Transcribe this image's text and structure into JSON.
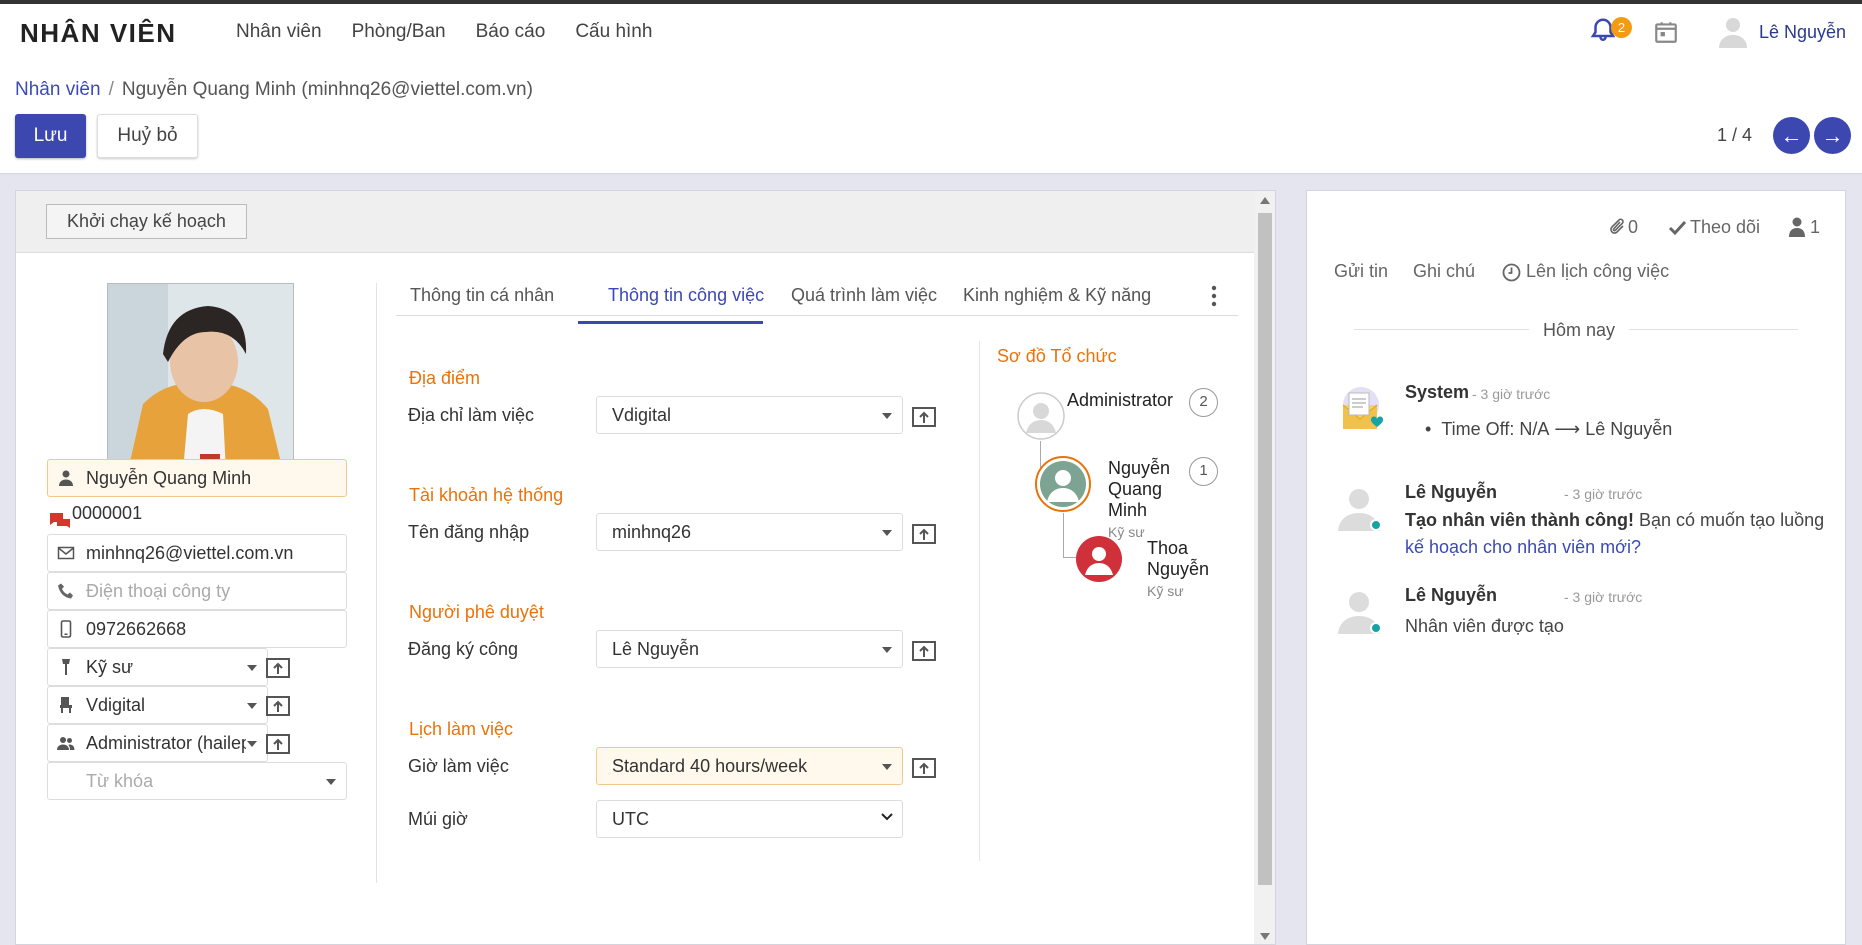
{
  "app": {
    "brand": "NHÂN VIÊN",
    "nav": [
      "Nhân viên",
      "Phòng/Ban",
      "Báo cáo",
      "Cấu hình"
    ],
    "notification_count": "2",
    "user_name": "Lê Nguyễn"
  },
  "breadcrumb": {
    "parent": "Nhân viên",
    "separator": "/",
    "current": "Nguyễn Quang Minh (minhnq26@viettel.com.vn)"
  },
  "actions": {
    "save": "Lưu",
    "cancel": "Huỷ bỏ"
  },
  "pager": {
    "value": "1 / 4"
  },
  "statusbar": {
    "start_plan": "Khởi chạy kế hoạch"
  },
  "employee": {
    "name": "Nguyễn Quang Minh",
    "code": "0000001",
    "email": "minhnq26@viettel.com.vn",
    "work_phone_placeholder": "Điện thoại công ty",
    "mobile": "0972662668",
    "job": "Kỹ sư",
    "department": "Vdigital",
    "manager": "Administrator (haileptit@",
    "tags_placeholder": "Từ khóa"
  },
  "tabs": [
    "Thông tin cá nhân",
    "Thông tin công việc",
    "Quá trình làm việc",
    "Kinh nghiệm & Kỹ năng"
  ],
  "work_info": {
    "location_section": "Địa điểm",
    "work_address_label": "Địa chỉ làm việc",
    "work_address": "Vdigital",
    "account_section": "Tài khoản hệ thống",
    "login_label": "Tên đăng nhập",
    "login": "minhnq26",
    "approver_section": "Người phê duyệt",
    "attendance_label": "Đăng ký công",
    "attendance": "Lê Nguyễn",
    "schedule_section": "Lịch làm việc",
    "hours_label": "Giờ làm việc",
    "hours": "Standard 40 hours/week",
    "tz_label": "Múi giờ",
    "tz": "UTC"
  },
  "org_chart": {
    "title": "Sơ đồ Tổ chức",
    "manager": {
      "name": "Administrator",
      "count": "2"
    },
    "self": {
      "name_lines": [
        "Nguyễn",
        "Quang",
        "Minh"
      ],
      "job": "Kỹ sư",
      "count": "1"
    },
    "sub": {
      "name_lines": [
        "Thoa",
        "Nguyễn"
      ],
      "job": "Kỹ sư"
    }
  },
  "chatter": {
    "attachments": "0",
    "follow": "Theo dõi",
    "followers": "1",
    "send_message": "Gửi tin",
    "log_note": "Ghi chú",
    "schedule_activity": "Lên lịch công việc",
    "today": "Hôm nay",
    "messages": [
      {
        "author": "System",
        "time": "- 3 giờ trước",
        "tracking_old": "Time Off: N/A",
        "tracking_new": "Lê Nguyễn"
      },
      {
        "author": "Lê Nguyễn",
        "time": "- 3 giờ trước",
        "bold": "Tạo nhân viên thành công!",
        "text": " Bạn có muốn tạo luồng",
        "link": "kế hoạch cho nhân viên mới?"
      },
      {
        "author": "Lê Nguyễn",
        "time": "- 3 giờ trước",
        "text": "Nhân viên được tạo"
      }
    ]
  },
  "colors": {
    "primary": "#3c48b0",
    "accent_orange": "#e8730c",
    "badge": "#f39c12",
    "online": "#17a2a5"
  }
}
